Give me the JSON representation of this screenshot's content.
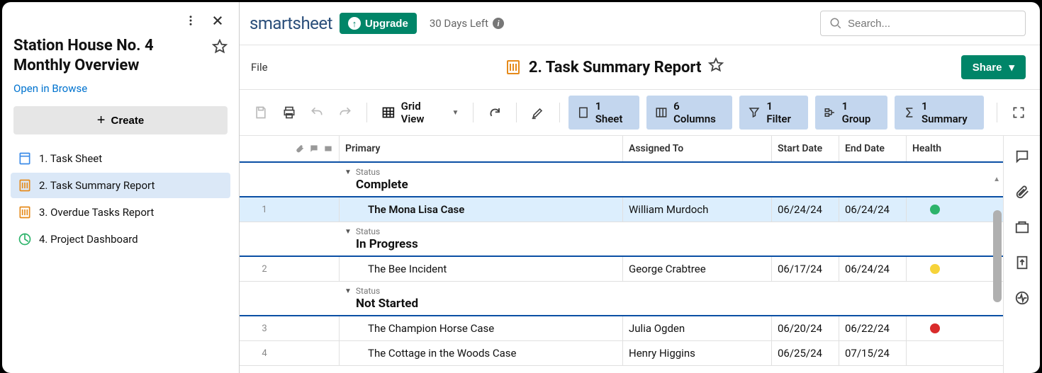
{
  "sidebar": {
    "workspace_title": "Station House No. 4 Monthly Overview",
    "open_browse": "Open in Browse",
    "create_label": "Create",
    "nav": [
      {
        "label": "1. Task Sheet",
        "icon": "sheet-icon"
      },
      {
        "label": "2. Task Summary Report",
        "icon": "report-icon"
      },
      {
        "label": "3. Overdue Tasks Report",
        "icon": "report-icon"
      },
      {
        "label": "4. Project Dashboard",
        "icon": "dashboard-icon"
      }
    ]
  },
  "topbar": {
    "brand": "smartsheet",
    "upgrade": "Upgrade",
    "days_left": "30 Days Left",
    "search_placeholder": "Search..."
  },
  "titlebar": {
    "file_menu": "File",
    "doc_title": "2. Task Summary Report",
    "share": "Share"
  },
  "toolbar": {
    "grid_view": "Grid View",
    "pills": {
      "sheet": "1 Sheet",
      "columns": "6 Columns",
      "filter": "1 Filter",
      "group": "1 Group",
      "summary": "1 Summary"
    }
  },
  "grid": {
    "headers": {
      "primary": "Primary",
      "assigned": "Assigned To",
      "start": "Start Date",
      "end": "End Date",
      "health": "Health"
    },
    "group_label": "Status",
    "groups": [
      {
        "status": "Complete",
        "rows": [
          {
            "num": "1",
            "primary": "The Mona Lisa Case",
            "assigned": "William Murdoch",
            "start": "06/24/24",
            "end": "06/24/24",
            "health": "#2cb36a",
            "selected": true
          }
        ]
      },
      {
        "status": "In Progress",
        "rows": [
          {
            "num": "2",
            "primary": "The Bee Incident",
            "assigned": "George Crabtree",
            "start": "06/17/24",
            "end": "06/24/24",
            "health": "#f6d33a"
          }
        ]
      },
      {
        "status": "Not Started",
        "rows": [
          {
            "num": "3",
            "primary": "The Champion Horse Case",
            "assigned": "Julia Ogden",
            "start": "06/20/24",
            "end": "06/22/24",
            "health": "#d92b2b"
          },
          {
            "num": "4",
            "primary": "The Cottage in the Woods Case",
            "assigned": "Henry Higgins",
            "start": "06/25/24",
            "end": "07/15/24",
            "health": ""
          }
        ]
      }
    ]
  }
}
